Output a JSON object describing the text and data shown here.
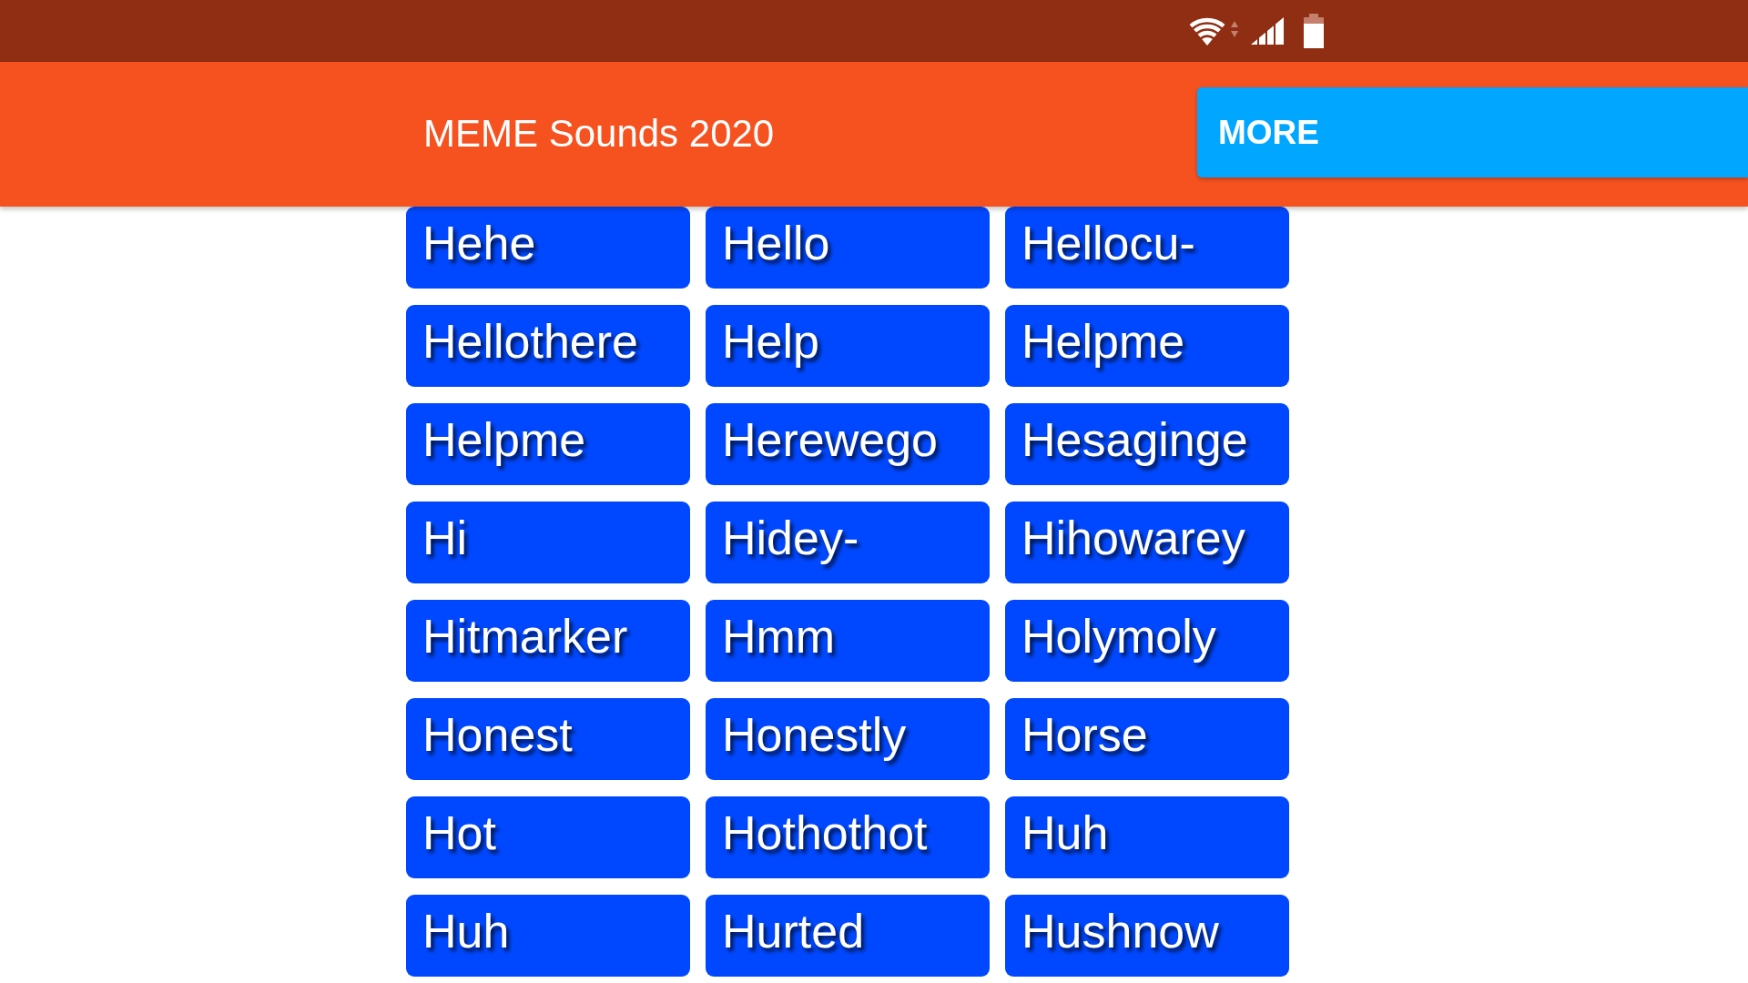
{
  "app_bar": {
    "title": "MEME Sounds 2020",
    "action_button": "MORE"
  },
  "sound_buttons": [
    "Hehe",
    "Hello",
    "Hellocu-",
    "Hellothere",
    "Help",
    "Helpme",
    "Helpme",
    "Herewego",
    "Hesaginge",
    "Hi",
    "Hidey-",
    "Hihowarey",
    "Hitmarker",
    "Hmm",
    "Holymoly",
    "Honest",
    "Honestly",
    "Horse",
    "Hot",
    "Hothothot",
    "Huh",
    "Huh",
    "Hurted",
    "Hushnow"
  ]
}
